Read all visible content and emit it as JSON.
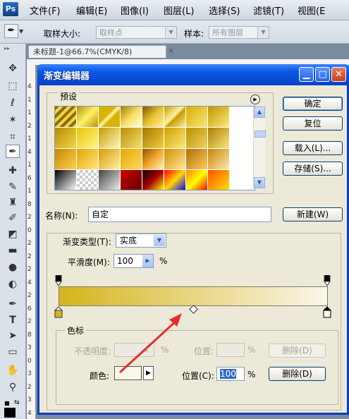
{
  "app": {
    "logo": "Ps"
  },
  "menu": [
    "文件(F)",
    "编辑(E)",
    "图像(I)",
    "图层(L)",
    "选择(S)",
    "滤镜(T)",
    "视图(E"
  ],
  "options": {
    "sample_size_label": "取样大小:",
    "sample_size_value": "取样点",
    "sample_label": "样本:",
    "sample_value": "所有图层"
  },
  "document": {
    "tab": "未标题-1@66.7%(CMYK/8)",
    "close": "×"
  },
  "ruler_v": [
    "4",
    "1",
    "1",
    "2",
    "1",
    "4",
    "1",
    "6",
    "1",
    "8",
    "2",
    "0",
    "2",
    "2",
    "2",
    "4",
    "2",
    "6",
    "2",
    "8",
    "3",
    "0",
    "3",
    "2",
    "3",
    "4"
  ],
  "dialog": {
    "title": "渐变编辑器",
    "presets_label": "预设",
    "buttons": {
      "ok": "确定",
      "reset": "复位",
      "load": "载入(L)...",
      "save": "存储(S)...",
      "new": "新建(W)"
    },
    "name_label": "名称(N):",
    "name_value": "自定",
    "gradient_type_label": "渐变类型(T):",
    "gradient_type_value": "实底",
    "smoothness_label": "平滑度(M):",
    "smoothness_value": "100",
    "smoothness_unit": "%",
    "color_stops": {
      "group_label": "色标",
      "opacity_label": "不透明度:",
      "opacity_unit": "%",
      "location_label_top": "位置:",
      "delete_top": "删除(D)",
      "color_label": "颜色:",
      "location_label": "位置(C):",
      "location_value": "100",
      "location_unit": "%",
      "delete": "删除(D)"
    },
    "gradient": {
      "start_color": "#d4b51e",
      "end_color": "#fbf6ea",
      "selected_stop": "right"
    }
  },
  "colors": {
    "title_blue": "#0a58e3",
    "dialog_bg": "#ece9d8",
    "annotation_arrow": "#e03030"
  }
}
